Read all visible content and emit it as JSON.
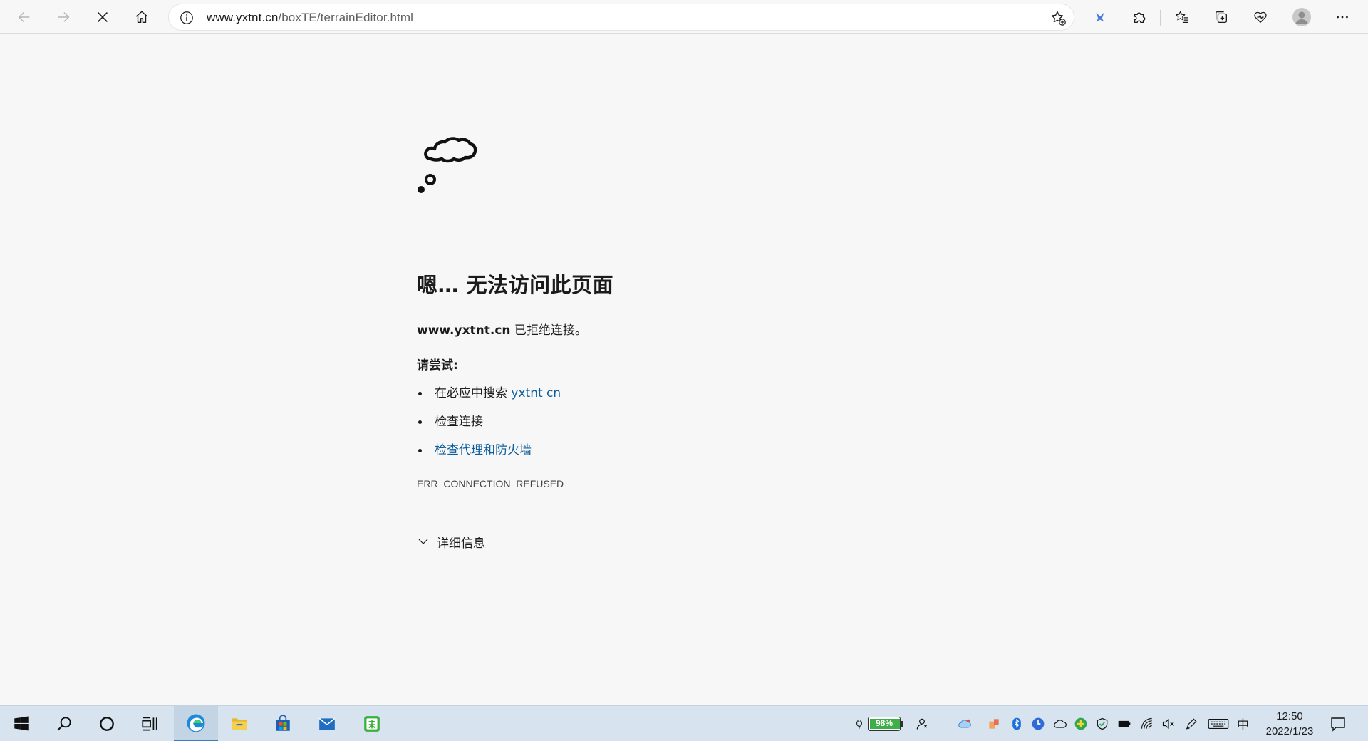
{
  "browser": {
    "url_host": "www.yxtnt.cn",
    "url_path": "/boxTE/terrainEditor.html",
    "buttons": [
      "back",
      "forward",
      "stop-loading",
      "home",
      "add-favorite",
      "extension-pin",
      "extensions",
      "favorites",
      "collections",
      "performance",
      "profile",
      "settings-more"
    ]
  },
  "error_page": {
    "title": "嗯… 无法访问此页面",
    "host": "www.yxtnt.cn",
    "message": " 已拒绝连接。",
    "try_title": "请尝试:",
    "suggestions": [
      {
        "prefix": "在必应中搜索 ",
        "link": "yxtnt cn"
      },
      {
        "prefix": "检查连接",
        "link": ""
      },
      {
        "prefix": "",
        "link": "检查代理和防火墙"
      }
    ],
    "error_code": "ERR_CONNECTION_REFUSED",
    "details_label": "详细信息"
  },
  "taskbar": {
    "apps": [
      "start",
      "search",
      "cortana",
      "task-view",
      "edge",
      "file-explorer",
      "store",
      "mail",
      "classroom-app"
    ],
    "battery_percent": "98%",
    "ime": "中",
    "time": "12:50",
    "date": "2022/1/23"
  },
  "colors": {
    "page_bg": "#f7f7f7",
    "link": "#0e5d9c",
    "taskbar_bg": "#d7e4ef",
    "taskbar_active_accent": "#3a7ac2"
  }
}
